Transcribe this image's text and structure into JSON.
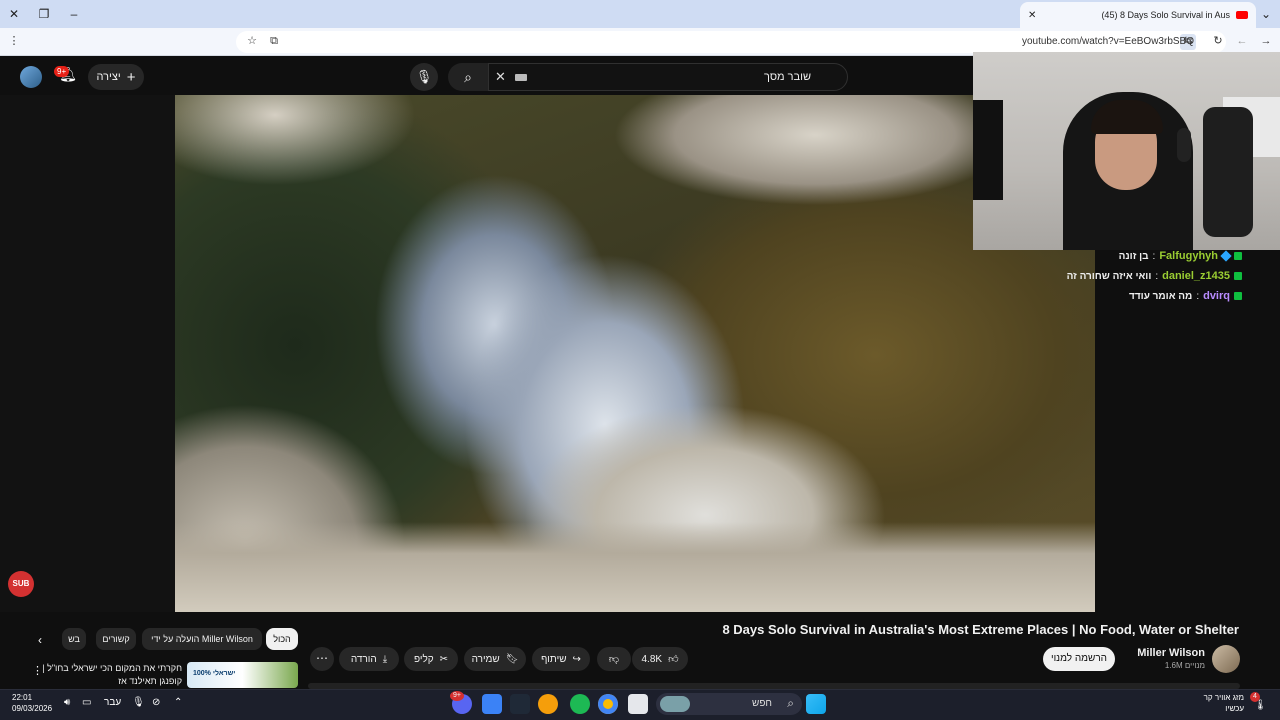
{
  "browser": {
    "tab_title": "(45) 8 Days Solo Survival in Aus",
    "url": "youtube.com/watch?v=EeBOw3rbSBQ"
  },
  "youtube": {
    "search_query": "שובר מסך",
    "create_label": "יצירה",
    "notifications_badge": "9+"
  },
  "chat": [
    {
      "user": "Falfugyhyh",
      "message": "בן זונה",
      "color": "#9acd32"
    },
    {
      "user": "daniel_z1435",
      "message": "וואי איזה שחורה זה",
      "color": "#9acd32"
    },
    {
      "user": "dvirq",
      "message": "מה אומר עודד",
      "color": "#b98cff"
    }
  ],
  "sub_badge": "SUB",
  "video": {
    "title": "8 Days Solo Survival in Australia's Most Extreme Places | No Food, Water or Shelter",
    "channel": "Miller Wilson",
    "subscribers": "1.6M מנויים",
    "subscribe_label": "הרשמה למנוי",
    "likes": "4.8K",
    "share_label": "שיתוף",
    "save_label": "שמירה",
    "clip_label": "קליפ",
    "download_label": "הורדה"
  },
  "chips": {
    "all": "הכול",
    "uploaded_by": "הועלה על ידי Miller Wilson",
    "related": "קשורים",
    "partial": "בש"
  },
  "recommendation": {
    "title": "חקרתי את המקום הכי ישראלי בחו\"ל | קופנגן תאילנד אז",
    "thumb_text": "100% ישראלי"
  },
  "taskbar": {
    "search_placeholder": "חפש",
    "time": "22:01",
    "date": "09/03/2026",
    "lang": "עבר",
    "weather_title": "מזג אוויר קר",
    "weather_sub": "עכשיו",
    "weather_badge": "4",
    "discord_badge": "9+"
  }
}
